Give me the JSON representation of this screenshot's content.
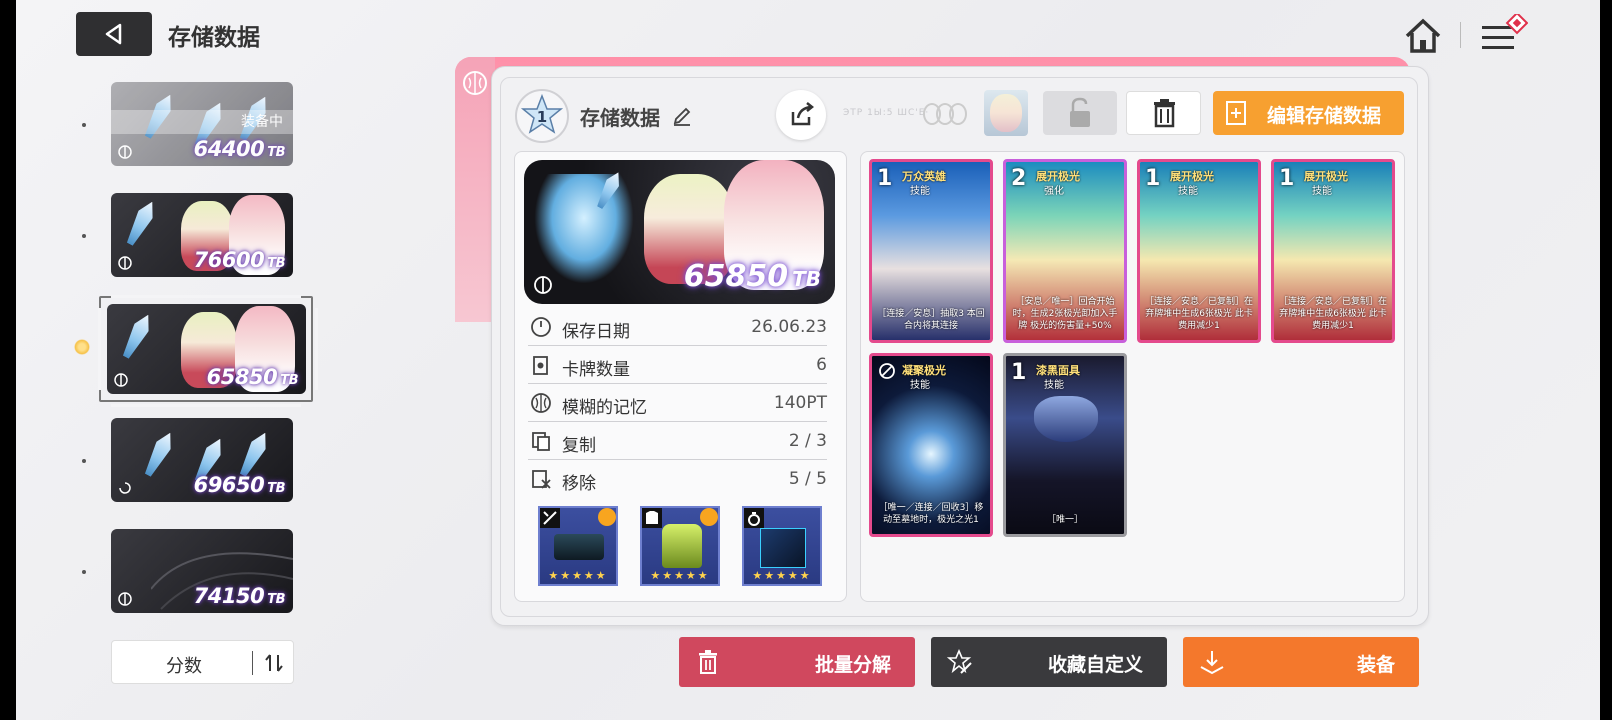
{
  "header": {
    "title": "存储数据"
  },
  "sidebar": {
    "slots": [
      {
        "score": "64400",
        "unit": "TB",
        "badge": "装备中",
        "equipped": true
      },
      {
        "score": "76600",
        "unit": "TB"
      },
      {
        "score": "65850",
        "unit": "TB",
        "selected": true
      },
      {
        "score": "69650",
        "unit": "TB"
      },
      {
        "score": "74150",
        "unit": "TB"
      }
    ],
    "sort": {
      "label": "分数"
    }
  },
  "panel": {
    "level": "1",
    "name": "存储数据",
    "faint_label": "ЭТР 1Ы:5 ШС'Е·",
    "edit_label": "编辑存储数据",
    "banner": {
      "score": "65850",
      "unit": "TB"
    },
    "info": [
      {
        "label": "保存日期",
        "value": "26.06.23",
        "icon": "clock-icon"
      },
      {
        "label": "卡牌数量",
        "value": "6",
        "icon": "cards-icon"
      },
      {
        "label": "模糊的记忆",
        "value": "140PT",
        "icon": "brain-icon"
      },
      {
        "label": "复制",
        "value": "2 / 3",
        "icon": "copy-icon"
      },
      {
        "label": "移除",
        "value": "5 / 5",
        "icon": "remove-icon"
      }
    ],
    "gear": [
      {
        "icon": "weapon-icon",
        "stars": "★★★★★"
      },
      {
        "icon": "armor-icon",
        "stars": "★★★★★"
      },
      {
        "icon": "ring-icon",
        "stars": "★★★★★"
      }
    ]
  },
  "deck": {
    "cards": [
      {
        "cost": "1",
        "name": "万众英雄",
        "type": "技能",
        "desc": "［连接／安息］抽取3 本回合内将其连接"
      },
      {
        "cost": "2",
        "name": "展开极光",
        "type": "强化",
        "desc": "［安息／唯一］回合开始时，生成2张极光卸加入手牌 极光的伤害量+50%"
      },
      {
        "cost": "1",
        "name": "展开极光",
        "type": "技能",
        "desc": "［连接／安息／已复制］在弃牌堆中生成6张极光 此卡费用减少1"
      },
      {
        "cost": "1",
        "name": "展开极光",
        "type": "技能",
        "desc": "［连接／安息／已复制］在弃牌堆中生成6张极光 此卡费用减少1"
      },
      {
        "cost": "",
        "name": "凝聚极光",
        "type": "技能",
        "desc": "［唯一／连接／回收3］移动至墓地时，极光之光1"
      },
      {
        "cost": "1",
        "name": "漆黑面具",
        "type": "技能",
        "desc": "［唯一］"
      }
    ]
  },
  "actions": {
    "decompose": "批量分解",
    "collection": "收藏自定义",
    "equip": "装备"
  },
  "colors": {
    "accent_orange": "#f7a030",
    "decompose_red": "#d0485e",
    "equip_orange": "#f4782c",
    "dark_button": "#3a3a3d"
  }
}
